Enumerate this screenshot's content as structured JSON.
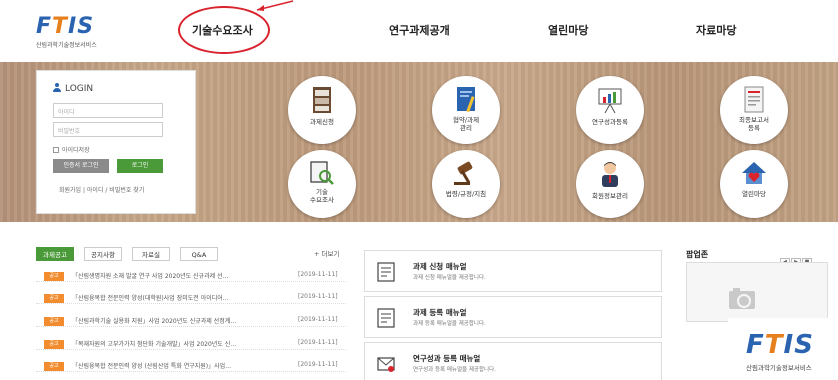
{
  "header": {
    "logo": {
      "text_f": "F",
      "text_t": "T",
      "text_is": "IS",
      "subtitle": "산림과학기술정보서비스"
    },
    "nav": [
      "기술수요조사",
      "연구과제공개",
      "열린마당",
      "자료마당"
    ]
  },
  "login": {
    "title": "LOGIN",
    "id_placeholder": "아이디",
    "pw_placeholder": "비밀번호",
    "save_id": "아이디저장",
    "cert_login": "인증서 로그인",
    "login": "로그인",
    "links": "회원가입 | 아이디 / 비밀번호 찾기"
  },
  "quick_menu": [
    {
      "label": "과제신청",
      "icon": "bookcase-icon"
    },
    {
      "label": "협약/과제\n관리",
      "icon": "notebook-icon"
    },
    {
      "label": "연구성과등록",
      "icon": "presentation-icon"
    },
    {
      "label": "최종보고서\n등록",
      "icon": "report-icon"
    },
    {
      "label": "기술\n수요조사",
      "icon": "magnifier-document-icon"
    },
    {
      "label": "법령/규정/지침",
      "icon": "gavel-icon"
    },
    {
      "label": "회원정보관리",
      "icon": "person-icon"
    },
    {
      "label": "열린마당",
      "icon": "house-heart-icon"
    }
  ],
  "notice": {
    "tabs": [
      "과제공고",
      "공지사항",
      "자료실",
      "Q&A"
    ],
    "active_tab": 0,
    "more": "+ 더보기",
    "items": [
      {
        "badge": "공고",
        "text": "「산림생명자원 소재 발굴 연구 사업 2020년도 신규과제 선…",
        "date": "[2019-11-11]"
      },
      {
        "badge": "공고",
        "text": "「산림융복합 전문인력 양성(대학원)사업 장미도전 아이디어…",
        "date": "[2019-11-11]"
      },
      {
        "badge": "공고",
        "text": "「산림과학기술 실용화 지원」사업 2020년도 신규과제 선정계…",
        "date": "[2019-11-11]"
      },
      {
        "badge": "공고",
        "text": "「목재자원의 고부가가치 첨단화 기술개발」사업 2020년도 신…",
        "date": "[2019-11-11]"
      },
      {
        "badge": "공고",
        "text": "「산림융복합 전문인력 양성 (산림산업 특화 연구지원)」사업…",
        "date": "[2019-11-11]"
      }
    ]
  },
  "manuals": [
    {
      "title": "과제 신청 매뉴얼",
      "desc": "과제 신청 매뉴얼을 제공합니다.",
      "icon": "document-list-icon"
    },
    {
      "title": "과제 등록 매뉴얼",
      "desc": "과제 등록 매뉴얼을 제공합니다.",
      "icon": "document-list-icon"
    },
    {
      "title": "연구성과 등록 매뉴얼",
      "desc": "연구성과 등록 매뉴얼을 제공합니다.",
      "icon": "mail-icon"
    }
  ],
  "popup": {
    "title": "팝업존",
    "controls": [
      "◀",
      "▶",
      "■"
    ],
    "logo": {
      "text_f": "F",
      "text_t": "T",
      "text_is": "IS",
      "subtitle": "산림과학기술정보서비스"
    }
  },
  "colors": {
    "brand_blue": "#2a63b0",
    "brand_orange": "#e67f1c",
    "green": "#4b9a3a",
    "badge_orange": "#f28c2f",
    "annotation_red": "#d9232d"
  }
}
